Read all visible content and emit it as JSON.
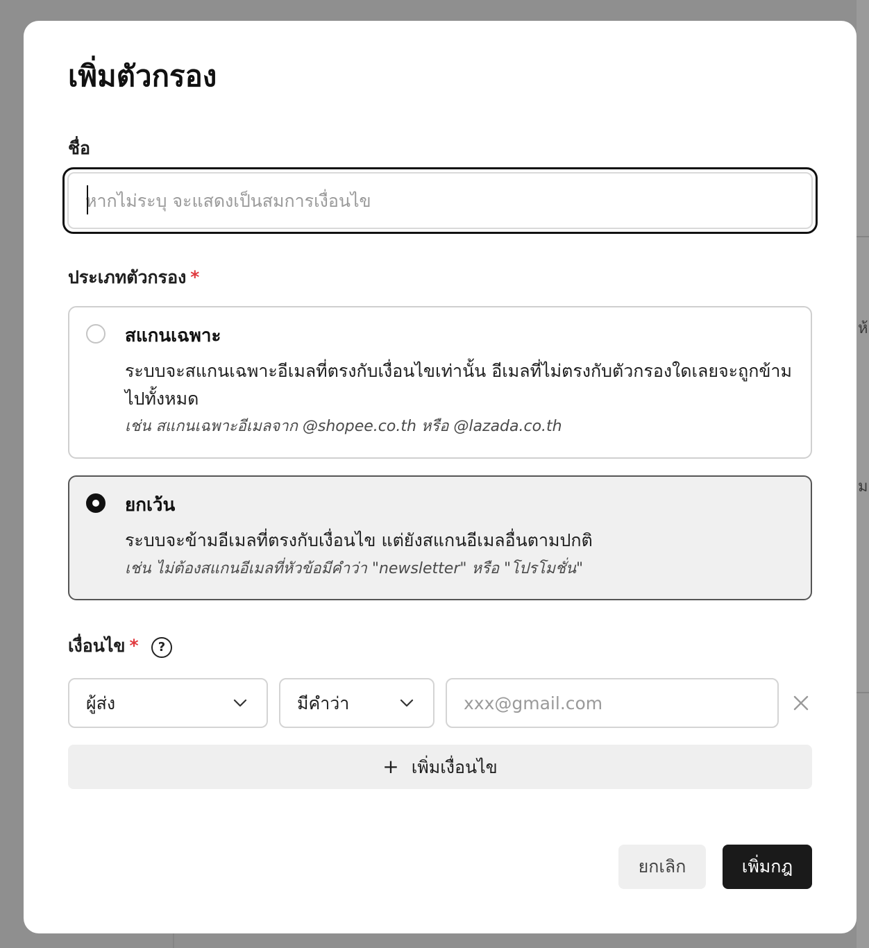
{
  "background": {
    "glyph_top": "ห้อ",
    "glyph_mid": "ม"
  },
  "dialog": {
    "title": "เพิ่มตัวกรอง",
    "name": {
      "label": "ชื่อ",
      "placeholder": "หากไม่ระบุ จะแสดงเป็นสมการเงื่อนไข",
      "value": ""
    },
    "filter_type": {
      "label": "ประเภทตัวกรอง",
      "required_mark": "*",
      "options": [
        {
          "title": "สแกนเฉพาะ",
          "description": "ระบบจะสแกนเฉพาะอีเมลที่ตรงกับเงื่อนไขเท่านั้น อีเมลที่ไม่ตรงกับตัวกรองใดเลยจะถูกข้ามไปทั้งหมด",
          "example": "เช่น สแกนเฉพาะอีเมลจาก @shopee.co.th หรือ @lazada.co.th",
          "selected": false
        },
        {
          "title": "ยกเว้น",
          "description": "ระบบจะข้ามอีเมลที่ตรงกับเงื่อนไข แต่ยังสแกนอีเมลอื่นตามปกติ",
          "example": "เช่น ไม่ต้องสแกนอีเมลที่หัวข้อมีคำว่า \"newsletter\" หรือ \"โปรโมชั่น\"",
          "selected": true
        }
      ]
    },
    "conditions": {
      "label": "เงื่อนไข",
      "required_mark": "*",
      "help_icon": "question-circle-icon",
      "help_glyph": "?",
      "rows": [
        {
          "field": "ผู้ส่ง",
          "operator": "มีคำว่า",
          "value": "",
          "value_placeholder": "xxx@gmail.com"
        }
      ],
      "add_label": "เพิ่มเงื่อนไข",
      "add_icon": "+"
    },
    "actions": {
      "cancel": "ยกเลิก",
      "submit": "เพิ่มกฎ"
    }
  },
  "colors": {
    "overlay": "#8f8f8f",
    "required": "#e0393e",
    "primary_button": "#1a1a1a",
    "selected_card": "#f0f0f0"
  }
}
